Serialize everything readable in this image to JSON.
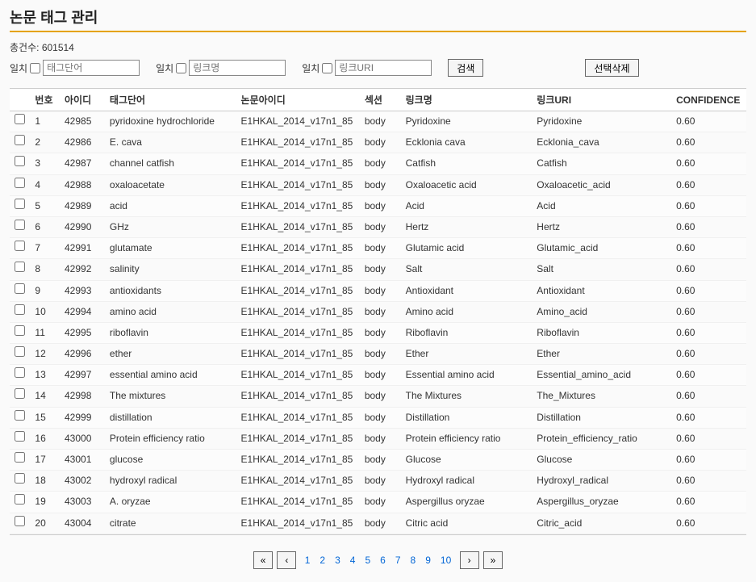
{
  "title": "논문 태그 관리",
  "total_label": "총건수:",
  "total_count": "601514",
  "filters": {
    "match_label": "일치",
    "tag_placeholder": "태그단어",
    "link_placeholder": "링크명",
    "uri_placeholder": "링크URI",
    "search_label": "검색",
    "delete_label": "선택삭제"
  },
  "columns": {
    "num": "번호",
    "id": "아이디",
    "tag": "태그단어",
    "paper": "논문아이디",
    "section": "섹션",
    "link": "링크명",
    "uri": "링크URI",
    "conf": "CONFIDENCE"
  },
  "rows": [
    {
      "num": "1",
      "id": "42985",
      "tag": "pyridoxine hydrochloride",
      "paper": "E1HKAL_2014_v17n1_85",
      "section": "body",
      "link": "Pyridoxine",
      "uri": "Pyridoxine",
      "conf": "0.60"
    },
    {
      "num": "2",
      "id": "42986",
      "tag": "E. cava",
      "paper": "E1HKAL_2014_v17n1_85",
      "section": "body",
      "link": "Ecklonia cava",
      "uri": "Ecklonia_cava",
      "conf": "0.60"
    },
    {
      "num": "3",
      "id": "42987",
      "tag": "channel catfish",
      "paper": "E1HKAL_2014_v17n1_85",
      "section": "body",
      "link": "Catfish",
      "uri": "Catfish",
      "conf": "0.60"
    },
    {
      "num": "4",
      "id": "42988",
      "tag": "oxaloacetate",
      "paper": "E1HKAL_2014_v17n1_85",
      "section": "body",
      "link": "Oxaloacetic acid",
      "uri": "Oxaloacetic_acid",
      "conf": "0.60"
    },
    {
      "num": "5",
      "id": "42989",
      "tag": "acid",
      "paper": "E1HKAL_2014_v17n1_85",
      "section": "body",
      "link": "Acid",
      "uri": "Acid",
      "conf": "0.60"
    },
    {
      "num": "6",
      "id": "42990",
      "tag": "GHz",
      "paper": "E1HKAL_2014_v17n1_85",
      "section": "body",
      "link": "Hertz",
      "uri": "Hertz",
      "conf": "0.60"
    },
    {
      "num": "7",
      "id": "42991",
      "tag": "glutamate",
      "paper": "E1HKAL_2014_v17n1_85",
      "section": "body",
      "link": "Glutamic acid",
      "uri": "Glutamic_acid",
      "conf": "0.60"
    },
    {
      "num": "8",
      "id": "42992",
      "tag": "salinity",
      "paper": "E1HKAL_2014_v17n1_85",
      "section": "body",
      "link": "Salt",
      "uri": "Salt",
      "conf": "0.60"
    },
    {
      "num": "9",
      "id": "42993",
      "tag": "antioxidants",
      "paper": "E1HKAL_2014_v17n1_85",
      "section": "body",
      "link": "Antioxidant",
      "uri": "Antioxidant",
      "conf": "0.60"
    },
    {
      "num": "10",
      "id": "42994",
      "tag": "amino acid",
      "paper": "E1HKAL_2014_v17n1_85",
      "section": "body",
      "link": "Amino acid",
      "uri": "Amino_acid",
      "conf": "0.60"
    },
    {
      "num": "11",
      "id": "42995",
      "tag": "riboflavin",
      "paper": "E1HKAL_2014_v17n1_85",
      "section": "body",
      "link": "Riboflavin",
      "uri": "Riboflavin",
      "conf": "0.60"
    },
    {
      "num": "12",
      "id": "42996",
      "tag": "ether",
      "paper": "E1HKAL_2014_v17n1_85",
      "section": "body",
      "link": "Ether",
      "uri": "Ether",
      "conf": "0.60"
    },
    {
      "num": "13",
      "id": "42997",
      "tag": "essential amino acid",
      "paper": "E1HKAL_2014_v17n1_85",
      "section": "body",
      "link": "Essential amino acid",
      "uri": "Essential_amino_acid",
      "conf": "0.60"
    },
    {
      "num": "14",
      "id": "42998",
      "tag": "The mixtures",
      "paper": "E1HKAL_2014_v17n1_85",
      "section": "body",
      "link": "The Mixtures",
      "uri": "The_Mixtures",
      "conf": "0.60"
    },
    {
      "num": "15",
      "id": "42999",
      "tag": "distillation",
      "paper": "E1HKAL_2014_v17n1_85",
      "section": "body",
      "link": "Distillation",
      "uri": "Distillation",
      "conf": "0.60"
    },
    {
      "num": "16",
      "id": "43000",
      "tag": "Protein efficiency ratio",
      "paper": "E1HKAL_2014_v17n1_85",
      "section": "body",
      "link": "Protein efficiency ratio",
      "uri": "Protein_efficiency_ratio",
      "conf": "0.60"
    },
    {
      "num": "17",
      "id": "43001",
      "tag": "glucose",
      "paper": "E1HKAL_2014_v17n1_85",
      "section": "body",
      "link": "Glucose",
      "uri": "Glucose",
      "conf": "0.60"
    },
    {
      "num": "18",
      "id": "43002",
      "tag": "hydroxyl radical",
      "paper": "E1HKAL_2014_v17n1_85",
      "section": "body",
      "link": "Hydroxyl radical",
      "uri": "Hydroxyl_radical",
      "conf": "0.60"
    },
    {
      "num": "19",
      "id": "43003",
      "tag": "A. oryzae",
      "paper": "E1HKAL_2014_v17n1_85",
      "section": "body",
      "link": "Aspergillus oryzae",
      "uri": "Aspergillus_oryzae",
      "conf": "0.60"
    },
    {
      "num": "20",
      "id": "43004",
      "tag": "citrate",
      "paper": "E1HKAL_2014_v17n1_85",
      "section": "body",
      "link": "Citric acid",
      "uri": "Citric_acid",
      "conf": "0.60"
    }
  ],
  "pager": {
    "first": "«",
    "prev": "‹",
    "pages": [
      "1",
      "2",
      "3",
      "4",
      "5",
      "6",
      "7",
      "8",
      "9",
      "10"
    ],
    "next": "›",
    "last": "»"
  }
}
